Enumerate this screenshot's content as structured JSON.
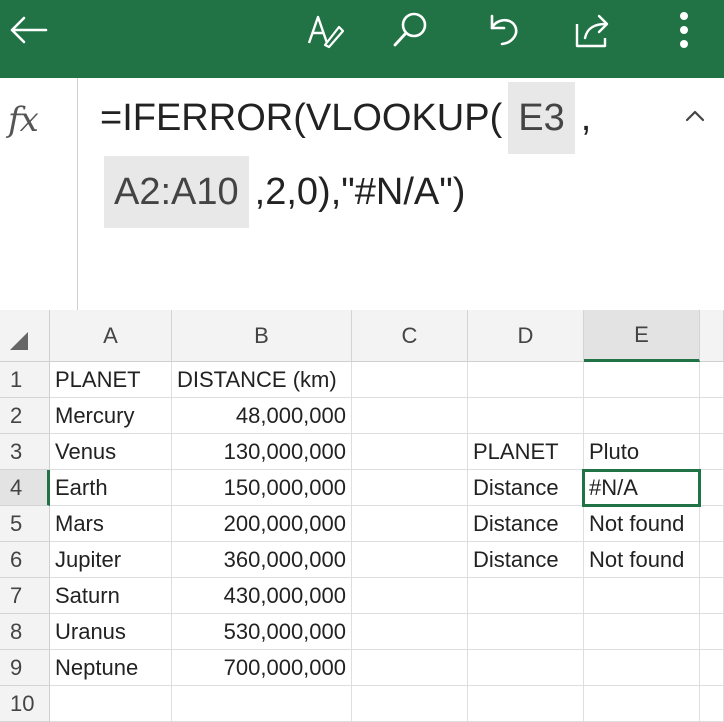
{
  "toolbar": {
    "icons": [
      "back-arrow-icon",
      "draw-pen-icon",
      "search-icon",
      "undo-icon",
      "share-icon",
      "more-vertical-icon"
    ],
    "accent": "#217346"
  },
  "formula_bar": {
    "fx_label": "fx",
    "line1_prefix": "=IFERROR(VLOOKUP(",
    "ref1": "E3",
    "line1_suffix": ",",
    "ref2": "A2:A10",
    "line2_suffix": ",2,0),\"#N/A\")"
  },
  "columns": [
    "A",
    "B",
    "C",
    "D",
    "E"
  ],
  "selected_column": "E",
  "selected_row": "4",
  "rows": [
    {
      "num": "1",
      "A": "PLANET",
      "B": "DISTANCE (km)",
      "C": "",
      "D": "",
      "E": ""
    },
    {
      "num": "2",
      "A": "Mercury",
      "B": "48,000,000",
      "C": "",
      "D": "",
      "E": ""
    },
    {
      "num": "3",
      "A": "Venus",
      "B": "130,000,000",
      "C": "",
      "D": "PLANET",
      "E": "Pluto"
    },
    {
      "num": "4",
      "A": "Earth",
      "B": "150,000,000",
      "C": "",
      "D": "Distance",
      "E": "#N/A"
    },
    {
      "num": "5",
      "A": "Mars",
      "B": "200,000,000",
      "C": "",
      "D": "Distance",
      "E": "Not found"
    },
    {
      "num": "6",
      "A": "Jupiter",
      "B": "360,000,000",
      "C": "",
      "D": "Distance",
      "E": "Not found"
    },
    {
      "num": "7",
      "A": "Saturn",
      "B": "430,000,000",
      "C": "",
      "D": "",
      "E": ""
    },
    {
      "num": "8",
      "A": "Uranus",
      "B": "530,000,000",
      "C": "",
      "D": "",
      "E": ""
    },
    {
      "num": "9",
      "A": "Neptune",
      "B": "700,000,000",
      "C": "",
      "D": "",
      "E": ""
    },
    {
      "num": "10",
      "A": "",
      "B": "",
      "C": "",
      "D": "",
      "E": ""
    }
  ]
}
